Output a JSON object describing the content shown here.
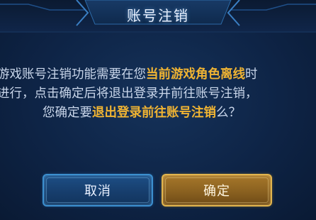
{
  "dialog": {
    "title": "账号注销",
    "message": {
      "line1": {
        "before": "游戏账号注销功能需要在您",
        "highlight": "当前游戏角色离线",
        "after": "时"
      },
      "line2": {
        "text": "进行，点击确定后将退出登录并前往账号注销，"
      },
      "line3": {
        "before": "您确定要",
        "highlight": "退出登录前往账号注销",
        "after": "么？"
      }
    },
    "buttons": {
      "cancel": "取消",
      "confirm": "确定"
    }
  },
  "colors": {
    "highlight": "#f0b433",
    "background": "#0e2446",
    "cancel_button": "#1d4f86",
    "confirm_button": "#a7782a"
  }
}
